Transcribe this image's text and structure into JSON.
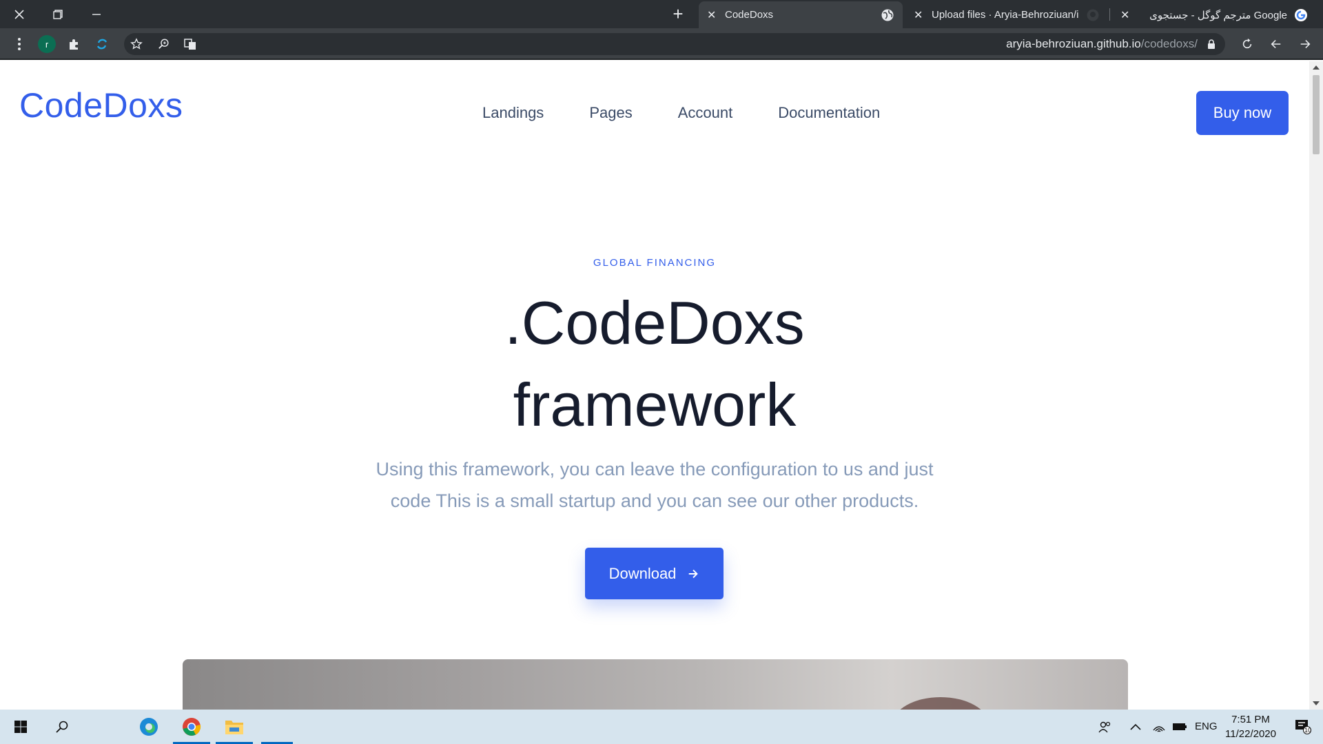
{
  "browser": {
    "tabs": [
      {
        "title": "CodeDoxs",
        "active": true
      },
      {
        "title": "Upload files · Aryia-Behroziuan/ir",
        "active": false
      },
      {
        "title": "مترجم گوگل - جستجوی Google",
        "active": false
      }
    ],
    "url_host": "aryia-behroziuan.github.io",
    "url_path": "/codedoxs/",
    "profile_initial": "r"
  },
  "site": {
    "brand": "CodeDoxs",
    "nav": [
      "Landings",
      "Pages",
      "Account",
      "Documentation"
    ],
    "buy_label": "Buy now"
  },
  "hero": {
    "eyebrow": "GLOBAL FINANCING",
    "headline_line1": ".CodeDoxs",
    "headline_line2": "framework",
    "lead_line1": "Using this framework, you can leave the configuration to us and just",
    "lead_line2": "code This is a small startup and you can see our other products.",
    "download_label": "Download"
  },
  "taskbar": {
    "language": "ENG",
    "time": "7:51 PM",
    "date": "11/22/2020",
    "notification_count": "10"
  },
  "colors": {
    "accent": "#335eea",
    "headline": "#161c2d",
    "muted": "#869ab8"
  }
}
